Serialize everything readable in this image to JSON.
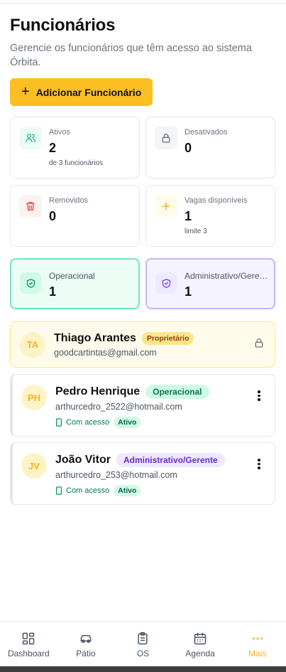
{
  "page": {
    "title": "Funcionários",
    "subtitle": "Gerencie os funcionários que têm acesso ao sistema Órbita.",
    "add_button": "Adicionar Funcionário"
  },
  "stats": {
    "ativos": {
      "label": "Ativos",
      "value": "2",
      "sub": "de 3 funcionários"
    },
    "desativados": {
      "label": "Desativados",
      "value": "0"
    },
    "removidos": {
      "label": "Removidos",
      "value": "0"
    },
    "vagas": {
      "label": "Vagas disponíveis",
      "value": "1",
      "sub": "limite 3"
    }
  },
  "roles": {
    "operacional": {
      "label": "Operacional",
      "value": "1"
    },
    "administrativo": {
      "label": "Administrativo/Gerente",
      "value": "1"
    }
  },
  "owner": {
    "initials": "TA",
    "name": "Thiago Arantes",
    "badge": "Proprietário",
    "email": "goodcartintas@gmail.com"
  },
  "employees": [
    {
      "initials": "PH",
      "name": "Pedro Henrique",
      "role": "Operacional",
      "email": "arthurcedro_2522@hotmail.com",
      "access": "Com acesso",
      "status": "Ativo"
    },
    {
      "initials": "JV",
      "name": "João Vitor",
      "role": "Administrativo/Gerente",
      "email": "arthurcedro_253@hotmail.com",
      "access": "Com acesso",
      "status": "Ativo"
    }
  ],
  "nav": {
    "items": [
      {
        "label": "Dashboard",
        "icon": "dashboard-icon"
      },
      {
        "label": "Pátio",
        "icon": "car-icon"
      },
      {
        "label": "OS",
        "icon": "clipboard-icon"
      },
      {
        "label": "Agenda",
        "icon": "calendar-icon"
      },
      {
        "label": "Mais",
        "icon": "more-icon"
      }
    ],
    "active": "Mais"
  },
  "colors": {
    "accent": "#fbbf24",
    "operacional": "#10b981",
    "administrativo": "#7c3aed"
  }
}
